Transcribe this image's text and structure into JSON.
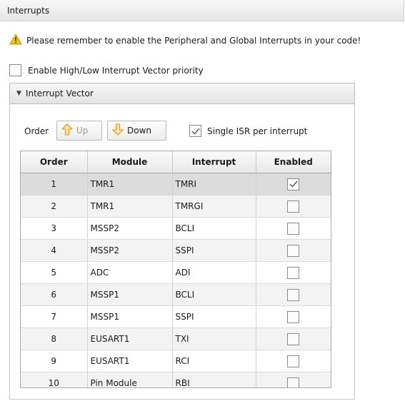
{
  "panel": {
    "title": "Interrupts"
  },
  "warning": {
    "text": "Please remember to enable the Peripheral and Global Interrupts in your code!"
  },
  "priority": {
    "label": "Enable High/Low Interrupt Vector priority",
    "checked": false
  },
  "vector_section": {
    "title": "Interrupt Vector",
    "order_label": "Order",
    "up_label": "Up",
    "down_label": "Down",
    "single_isr_label": "Single ISR per interrupt",
    "single_isr_checked": true
  },
  "table": {
    "columns": [
      "Order",
      "Module",
      "Interrupt",
      "Enabled"
    ],
    "rows": [
      {
        "order": "1",
        "module": "TMR1",
        "interrupt": "TMRI",
        "enabled": true
      },
      {
        "order": "2",
        "module": "TMR1",
        "interrupt": "TMRGI",
        "enabled": false
      },
      {
        "order": "3",
        "module": "MSSP2",
        "interrupt": "BCLI",
        "enabled": false
      },
      {
        "order": "4",
        "module": "MSSP2",
        "interrupt": "SSPI",
        "enabled": false
      },
      {
        "order": "5",
        "module": "ADC",
        "interrupt": "ADI",
        "enabled": false
      },
      {
        "order": "6",
        "module": "MSSP1",
        "interrupt": "BCLI",
        "enabled": false
      },
      {
        "order": "7",
        "module": "MSSP1",
        "interrupt": "SSPI",
        "enabled": false
      },
      {
        "order": "8",
        "module": "EUSART1",
        "interrupt": "TXI",
        "enabled": false
      },
      {
        "order": "9",
        "module": "EUSART1",
        "interrupt": "RCI",
        "enabled": false
      },
      {
        "order": "10",
        "module": "Pin Module",
        "interrupt": "RBI",
        "enabled": false
      }
    ]
  },
  "icons": {
    "warning": "warning-icon",
    "up": "arrow-up-icon",
    "down": "arrow-down-icon",
    "caret": "caret-down-icon",
    "check": "check-icon"
  },
  "colors": {
    "arrow_orange": "#f0a020",
    "warning_yellow": "#f5c400",
    "selected_row": "#dcdcdc"
  }
}
